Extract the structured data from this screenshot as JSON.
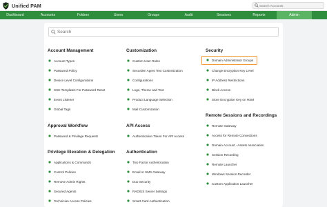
{
  "app": {
    "name": "Unified PAM"
  },
  "top_search": {
    "placeholder": "Search Accounts"
  },
  "nav": [
    {
      "label": "Dashboard"
    },
    {
      "label": "Accounts"
    },
    {
      "label": "Folders"
    },
    {
      "label": "Users"
    },
    {
      "label": "Groups"
    },
    {
      "label": "Audit"
    },
    {
      "label": "Sessions"
    },
    {
      "label": "Reports"
    },
    {
      "label": "Admin"
    }
  ],
  "main_search": {
    "placeholder": "Search"
  },
  "colors": {
    "brand_green": "#2f8d3e",
    "active_tab": "#5ab463",
    "highlight": "#f29b3a"
  },
  "sections": {
    "account_management": {
      "title": "Account Management",
      "items": [
        "Account Types",
        "Password Policy",
        "Device Level Configurations",
        "SSH Templates For Password Reset",
        "Event Listener",
        "Global Tags"
      ]
    },
    "approval_workflow": {
      "title": "Approval Workflow",
      "items": [
        "Password & Privilege Requests"
      ]
    },
    "privilege_elevation": {
      "title": "Privilege Elevation & Delegation",
      "items": [
        "Applications & Commands",
        "Control Policies",
        "Remove Admin Rights",
        "Secured Agents",
        "Technician Access Policies"
      ]
    },
    "customization": {
      "title": "Customization",
      "items": [
        "Custom User Roles",
        "Securden Agent Text Customization",
        "Configurations",
        "Logo, Theme and Text",
        "Product Language Selection",
        "Mail Customization"
      ]
    },
    "api_access": {
      "title": "API Access",
      "items": [
        "Authentication Token For API Access"
      ]
    },
    "authentication": {
      "title": "Authentication",
      "items": [
        "Two Factor Authentication",
        "Email or SMS Gateway",
        "Duo Security",
        "RADIUS Server Settings",
        "Smart Card Authentication"
      ]
    },
    "security": {
      "title": "Security",
      "items": [
        "Domain Administrator Groups",
        "Change Encryption Key Level",
        "IP Address Restrictions",
        "Block Access",
        "Store Encryption Key on HSM"
      ]
    },
    "remote_sessions": {
      "title": "Remote Sessions and Recordings",
      "items": [
        "Remote Gateway",
        "Access for Remote Connections",
        "Domain Account - Assets Association",
        "Session Recording",
        "Remote Launcher",
        "Windows Session Recorder",
        "Custom Application Launcher"
      ]
    }
  }
}
